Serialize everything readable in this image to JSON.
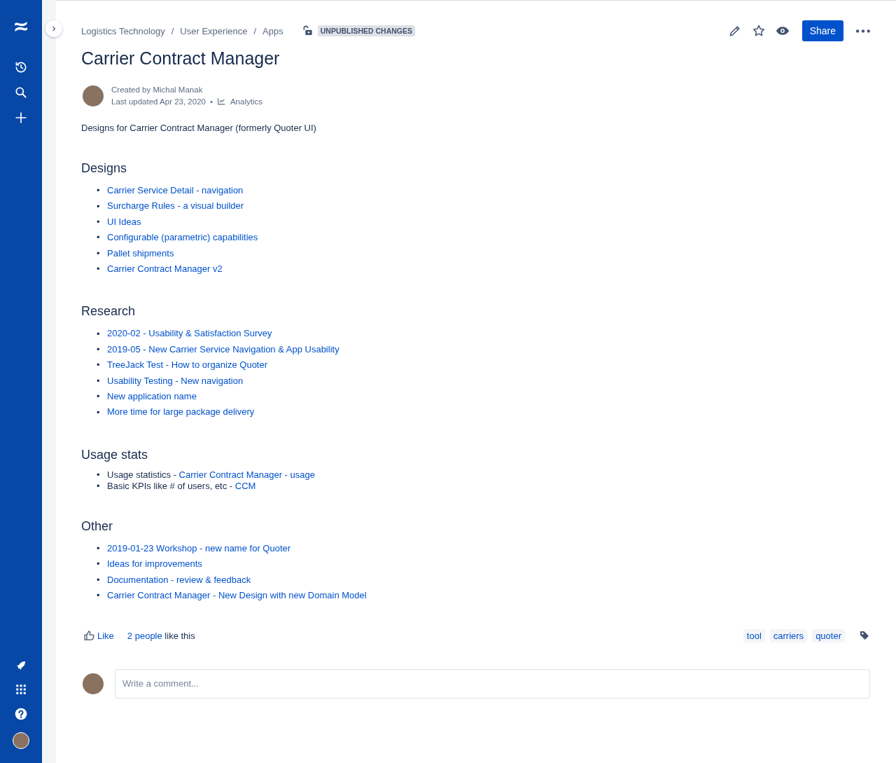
{
  "breadcrumbs": [
    "Logistics Technology",
    "User Experience",
    "Apps"
  ],
  "breadcrumb_separator": "/",
  "bullet": "•",
  "status_lozenge": "UNPUBLISHED CHANGES",
  "toolbar": {
    "share": "Share"
  },
  "title": "Carrier Contract Manager",
  "byline": {
    "created": "Created by Michal Manak",
    "updated": "Last updated Apr 23, 2020",
    "separator": "•",
    "analytics": "Analytics"
  },
  "description": "Designs for Carrier Contract Manager (formerly Quoter UI)",
  "sections": [
    {
      "heading": "Designs",
      "items": [
        {
          "link": "Carrier Service Detail - navigation"
        },
        {
          "link": "Surcharge Rules - a visual builder"
        },
        {
          "link": "UI Ideas"
        },
        {
          "link": "Configurable (parametric) capabilities"
        },
        {
          "link": "Pallet shipments"
        },
        {
          "link": "Carrier Contract Manager v2"
        }
      ]
    },
    {
      "heading": "Research",
      "items": [
        {
          "link": "2020-02 - Usability & Satisfaction Survey"
        },
        {
          "link": "2019-05 - New Carrier Service Navigation & App Usability"
        },
        {
          "link": "TreeJack Test - How to organize Quoter"
        },
        {
          "link": "Usability Testing - New navigation"
        },
        {
          "link": "New application name"
        },
        {
          "link": "More time for large package delivery"
        }
      ]
    },
    {
      "heading": "Usage stats",
      "items": [
        {
          "prefix": "Usage statistics - ",
          "link": "Carrier Contract Manager - usage"
        },
        {
          "prefix": "Basic KPIs like # of users, etc - ",
          "link": "CCM"
        }
      ]
    },
    {
      "heading": "Other",
      "items": [
        {
          "link": "2019-01-23 Workshop - new name for Quoter"
        },
        {
          "link": "Ideas for improvements"
        },
        {
          "link": "Documentation - review & feedback"
        },
        {
          "link": "Carrier Contract Manager - New Design with new Domain Model"
        }
      ]
    }
  ],
  "likes": {
    "button": "Like",
    "people": "2 people",
    "suffix": " like this"
  },
  "labels": [
    "tool",
    "carriers",
    "quoter"
  ],
  "comment": {
    "placeholder": "Write a comment..."
  }
}
